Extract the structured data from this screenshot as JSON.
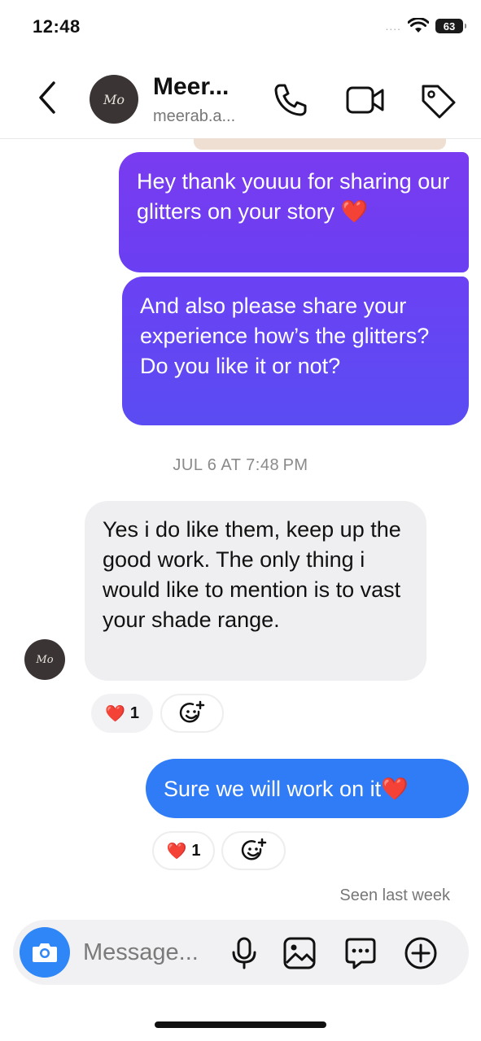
{
  "status_bar": {
    "time": "12:48",
    "signal": "....",
    "battery": "63"
  },
  "header": {
    "contact_name": "Meer...",
    "contact_username": "meerab.a...",
    "avatar_monogram": "Mo",
    "icons": [
      "back-chevron-icon",
      "phone-icon",
      "video-camera-icon",
      "tag-icon"
    ]
  },
  "messages": {
    "out_1": "Hey thank youuu for sharing our glitters on your story ❤️",
    "out_2": "And also please share your experience how’s the glitters? Do you like it or not?",
    "date_separator": "JUL 6 AT 7:48 PM",
    "in_1": "Yes i do like them, keep up the good work. The only thing i would like to mention is to vast your shade range.",
    "in_1_reaction": {
      "emoji": "❤️",
      "count": "1"
    },
    "out_3": "Sure we will work on it❤️",
    "out_3_reaction": {
      "emoji": "❤️",
      "count": "1"
    },
    "seen": "Seen last week"
  },
  "composer": {
    "placeholder": "Message...",
    "icons": [
      "camera-icon",
      "microphone-icon",
      "gallery-icon",
      "sticker-chat-icon",
      "plus-icon"
    ]
  },
  "colors": {
    "outgoing_purple_top": "#7a3cf0",
    "outgoing_purple_bottom": "#5a4cf2",
    "outgoing_blue": "#2f7cf6",
    "incoming_gray": "#efeff1",
    "camera_button": "#2f86f6"
  }
}
